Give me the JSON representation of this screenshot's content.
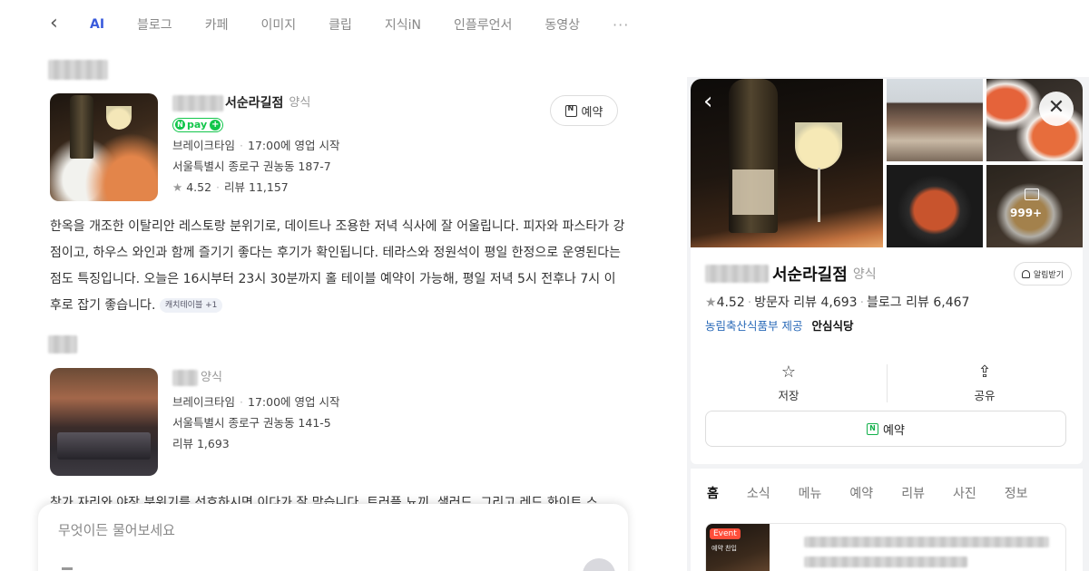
{
  "nav": {
    "back_icon": "chevron-left-icon",
    "tabs": [
      "AI",
      "블로그",
      "카페",
      "이미지",
      "클립",
      "지식iN",
      "인플루언서",
      "동영상"
    ],
    "active_tab": "AI",
    "more_label": "···"
  },
  "results": [
    {
      "name": "서순라길점",
      "category": "양식",
      "pay_label": "pay",
      "status": "브레이크타임",
      "open_time": "17:00에 영업 시작",
      "address": "서울특별시 종로구 권농동 187-7",
      "rating": "4.52",
      "reviews": "리뷰 11,157",
      "reserve_label": "예약"
    },
    {
      "category": "양식",
      "status": "브레이크타임",
      "open_time": "17:00에 영업 시작",
      "address": "서울특별시 종로구 권농동 141-5",
      "reviews": "리뷰 1,693"
    }
  ],
  "description": "한옥을 개조한 이탈리안 레스토랑 분위기로, 데이트나 조용한 저녁 식사에 잘 어울립니다. 피자와 파스타가 강점이고, 하우스 와인과 함께 즐기기 좋다는 후기가 확인됩니다. 테라스와 정원석이 평일 한정으로 운영된다는 점도 특징입니다. 오늘은 16시부터 23시 30분까지 홀 테이블 예약이 가능해, 평일 저녁 5시 전후나 7시 이후로 잡기 좋습니다.",
  "description_chip": "캐치테이블 +1",
  "truncated_text": "창가 자리와 야장 분위기를 선호하시면 이다가 잘 맞습니다. 트러플 뇨끼, 샐러드, 그리고 레드 화이트 스",
  "ask": {
    "placeholder": "무엇이든 물어보세요"
  },
  "panel": {
    "photo_count": "999+",
    "name": "서순라길점",
    "category": "양식",
    "alarm_label": "알림받기",
    "rating": "4.52",
    "visitor_reviews": "방문자 리뷰 4,693",
    "blog_reviews": "블로그 리뷰 6,467",
    "source_link": "농림축산식품부 제공",
    "source_badge": "안심식당",
    "save_label": "저장",
    "share_label": "공유",
    "reserve_label": "예약",
    "tabs": [
      "홈",
      "소식",
      "메뉴",
      "예약",
      "리뷰",
      "사진",
      "정보"
    ],
    "active_tab": "홈",
    "event_badge": "Event",
    "event_sub": "예약 찬입"
  },
  "colors": {
    "accent": "#3a5bdc",
    "npay_green": "#12c64b",
    "link_blue": "#2a6ab8"
  }
}
